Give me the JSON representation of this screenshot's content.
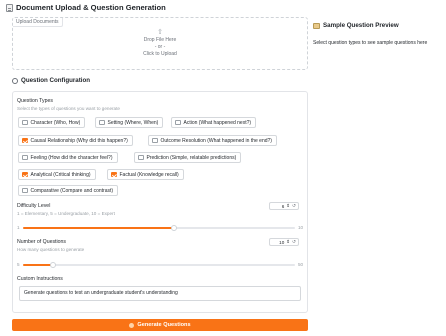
{
  "page": {
    "title": "Document Upload & Question Generation"
  },
  "upload": {
    "tag": "Upload Documents",
    "drop_text": "Drop File Here",
    "or_text": "- or -",
    "click_text": "Click to Upload"
  },
  "preview": {
    "title": "Sample Question Preview",
    "placeholder": "Select question types to see sample questions here"
  },
  "config": {
    "title": "Question Configuration",
    "question_types": {
      "label": "Question Types",
      "hint": "Select the types of questions you want to generate",
      "options": [
        {
          "label": "Character (Who, How)",
          "checked": false
        },
        {
          "label": "Setting (Where, When)",
          "checked": false
        },
        {
          "label": "Action (What happened next?)",
          "checked": false
        },
        {
          "label": "Causal Relationship (Why did this happen?)",
          "checked": true
        },
        {
          "label": "Outcome Resolution (What happened in the end?)",
          "checked": false
        },
        {
          "label": "Feeling (How did the character feel?)",
          "checked": false
        },
        {
          "label": "Prediction (Simple, relatable predictions)",
          "checked": false
        },
        {
          "label": "Analytical (Critical thinking)",
          "checked": true
        },
        {
          "label": "Factual (Knowledge recall)",
          "checked": true
        },
        {
          "label": "Comparative (Compare and contrast)",
          "checked": false
        }
      ]
    },
    "difficulty": {
      "label": "Difficulty Level",
      "hint": "1 = Elementary, 5 = Undergraduate, 10 = Expert",
      "value": "6",
      "min": "1",
      "max": "10",
      "fraction": 0.555
    },
    "num_questions": {
      "label": "Number of Questions",
      "hint": "How many questions to generate",
      "value": "10",
      "min": "5",
      "max": "50",
      "fraction": 0.111
    },
    "custom": {
      "label": "Custom Instructions",
      "value": "Generate questions to test an undergraduate student's understanding"
    }
  },
  "generate": {
    "label": "Generate Questions"
  },
  "colors": {
    "accent": "#f97316"
  }
}
